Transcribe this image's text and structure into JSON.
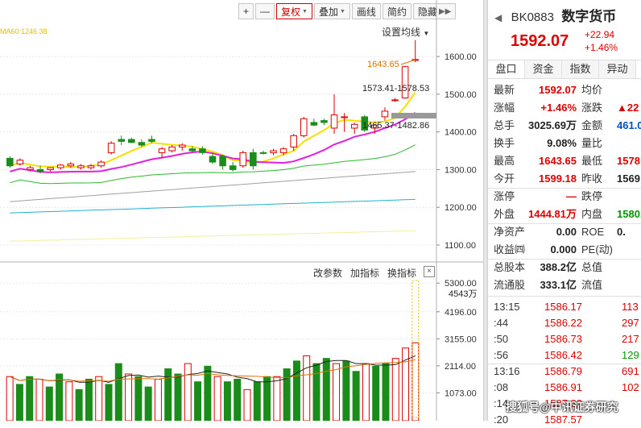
{
  "toolbar": {
    "plus": "+",
    "minus": "—",
    "fuquan": "复权",
    "diejia": "叠加",
    "huaxian": "画线",
    "jianyue": "简约",
    "yincang": "隐藏"
  },
  "chart_top": {
    "set_ma": "设置均线",
    "ma_legend": "MA60:1246.38",
    "price_axis": [
      "1600.00",
      "1500.00",
      "1400.00",
      "1300.00",
      "1200.00",
      "1100.00"
    ],
    "ann_high": "1643.65",
    "ann_1": "1573.41-1578.53",
    "ann_2": "1465.37-1482.86"
  },
  "chart_bottom": {
    "controls": [
      "改参数",
      "加指标",
      "换指标"
    ],
    "close": "×",
    "vol_axis": [
      "5300.00",
      "4196.00",
      "3155.00",
      "2114.00",
      "1073.00"
    ],
    "vol_label": "4543万"
  },
  "chart_data": {
    "type": "candlestick",
    "ylim": [
      1070,
      1690
    ],
    "candles": [
      [
        1330,
        1335,
        1305,
        1310
      ],
      [
        1315,
        1330,
        1310,
        1325
      ],
      [
        1300,
        1310,
        1295,
        1305
      ],
      [
        1300,
        1310,
        1290,
        1295
      ],
      [
        1300,
        1305,
        1295,
        1305
      ],
      [
        1305,
        1315,
        1300,
        1312
      ],
      [
        1310,
        1320,
        1305,
        1315
      ],
      [
        1305,
        1315,
        1300,
        1310
      ],
      [
        1305,
        1315,
        1300,
        1310
      ],
      [
        1310,
        1325,
        1305,
        1320
      ],
      [
        1345,
        1375,
        1340,
        1370
      ],
      [
        1380,
        1390,
        1365,
        1375
      ],
      [
        1380,
        1385,
        1370,
        1372
      ],
      [
        1372,
        1380,
        1360,
        1365
      ],
      [
        1380,
        1390,
        1370,
        1375
      ],
      [
        1345,
        1360,
        1330,
        1355
      ],
      [
        1350,
        1365,
        1345,
        1360
      ],
      [
        1360,
        1370,
        1350,
        1365
      ],
      [
        1355,
        1362,
        1345,
        1350
      ],
      [
        1355,
        1362,
        1340,
        1345
      ],
      [
        1335,
        1345,
        1315,
        1320
      ],
      [
        1335,
        1340,
        1300,
        1310
      ],
      [
        1310,
        1320,
        1295,
        1300
      ],
      [
        1310,
        1350,
        1305,
        1345
      ],
      [
        1345,
        1355,
        1300,
        1310
      ],
      [
        1345,
        1350,
        1340,
        1343
      ],
      [
        1345,
        1355,
        1338,
        1350
      ],
      [
        1345,
        1360,
        1338,
        1355
      ],
      [
        1360,
        1395,
        1350,
        1390
      ],
      [
        1390,
        1440,
        1385,
        1435
      ],
      [
        1425,
        1435,
        1415,
        1418
      ],
      [
        1430,
        1435,
        1418,
        1425
      ],
      [
        1410,
        1500,
        1395,
        1445
      ],
      [
        1440,
        1450,
        1400,
        1440
      ],
      [
        1410,
        1425,
        1395,
        1420
      ],
      [
        1440,
        1445,
        1400,
        1405
      ],
      [
        1410,
        1420,
        1395,
        1418
      ],
      [
        1440,
        1465,
        1430,
        1455
      ],
      [
        1485,
        1490,
        1480,
        1485
      ],
      [
        1490,
        1575,
        1488,
        1573
      ],
      [
        1590,
        1643.65,
        1585,
        1592
      ]
    ],
    "volumes": [
      1700,
      1400,
      1700,
      1600,
      1300,
      1800,
      1500,
      1200,
      1600,
      1700,
      1400,
      2200,
      1800,
      1700,
      1300,
      1600,
      2000,
      1800,
      2200,
      1500,
      2100,
      1700,
      1500,
      1600,
      1200,
      1500,
      1700,
      1700,
      2000,
      2300,
      2500,
      2200,
      2400,
      2200,
      2300,
      1900,
      2200,
      2100,
      2200,
      2400,
      2800,
      3000
    ],
    "vol_ylim": [
      0,
      5400
    ]
  },
  "stock": {
    "code": "BK0883",
    "name": "数字货币",
    "price": "1592.07",
    "change": "+22.94",
    "pct": "+1.46%"
  },
  "tabs": [
    "盘口",
    "资金",
    "指数",
    "异动"
  ],
  "quote": [
    {
      "l1": "最新",
      "v1": "1592.07",
      "c1": "red",
      "l2": "均价",
      "v2": ""
    },
    {
      "l1": "涨幅",
      "v1": "+1.46%",
      "c1": "red",
      "l2": "涨跌",
      "v2": "▲22",
      "c2": "red"
    },
    {
      "l1": "总手",
      "v1": "3025.69万",
      "c1": "black",
      "l2": "金额",
      "v2": "461.0",
      "c2": "blue"
    },
    {
      "l1": "换手",
      "v1": "9.08%",
      "c1": "black",
      "l2": "量比",
      "v2": ""
    },
    {
      "l1": "最高",
      "v1": "1643.65",
      "c1": "red",
      "l2": "最低",
      "v2": "1578",
      "c2": "red"
    },
    {
      "l1": "今开",
      "v1": "1599.18",
      "c1": "red",
      "l2": "昨收",
      "v2": "1569",
      "c2": "black"
    },
    {
      "l1": "涨停",
      "v1": "—",
      "c1": "red",
      "l2": "跌停",
      "v2": ""
    },
    {
      "l1": "外盘",
      "v1": "1444.81万",
      "c1": "red",
      "l2": "内盘",
      "v2": "1580.8",
      "c2": "green"
    },
    {
      "l1": "净资产",
      "v1": "0.00",
      "c1": "black",
      "l2": "ROE",
      "v2": "0.",
      "c2": "black"
    },
    {
      "l1": "收益㈣",
      "v1": "0.000",
      "c1": "black",
      "l2": "PE(动)",
      "v2": ""
    },
    {
      "l1": "总股本",
      "v1": "388.2亿",
      "c1": "black",
      "l2": "总值",
      "v2": ""
    },
    {
      "l1": "流通股",
      "v1": "333.1亿",
      "c1": "black",
      "l2": "流值",
      "v2": ""
    }
  ],
  "ticks": [
    {
      "t": "13:15",
      "p": "1586.17",
      "v": "113",
      "c": "red"
    },
    {
      "t": ":44",
      "p": "1586.22",
      "v": "297",
      "c": "red"
    },
    {
      "t": ":50",
      "p": "1586.73",
      "v": "217",
      "c": "red"
    },
    {
      "t": ":56",
      "p": "1586.42",
      "v": "129",
      "c": "green"
    },
    {
      "t": "13:16",
      "p": "1586.79",
      "v": "691",
      "c": "red"
    },
    {
      "t": ":08",
      "p": "1586.91",
      "v": "102",
      "c": "red"
    },
    {
      "t": ":14",
      "p": "1587.32",
      "v": "",
      "c": "red"
    },
    {
      "t": ":20",
      "p": "1587.57",
      "v": "",
      "c": "red"
    }
  ],
  "watermark": "搜狐号@中讯证券研究"
}
